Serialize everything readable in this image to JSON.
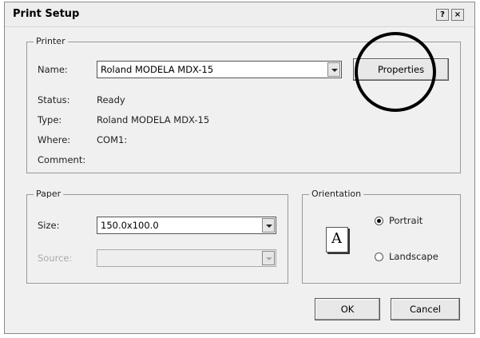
{
  "window": {
    "title": "Print Setup",
    "help_label": "?",
    "close_label": "×"
  },
  "printer": {
    "group_label": "Printer",
    "name_label": "Name:",
    "name_value": "Roland MODELA MDX-15",
    "properties_label": "Properties",
    "status_label": "Status:",
    "status_value": "Ready",
    "type_label": "Type:",
    "type_value": "Roland MODELA MDX-15",
    "where_label": "Where:",
    "where_value": "COM1:",
    "comment_label": "Comment:",
    "comment_value": ""
  },
  "paper": {
    "group_label": "Paper",
    "size_label": "Size:",
    "size_value": "150.0x100.0",
    "source_label": "Source:",
    "source_value": ""
  },
  "orientation": {
    "group_label": "Orientation",
    "icon_letter": "A",
    "portrait_label": "Portrait",
    "landscape_label": "Landscape",
    "selected": "Portrait"
  },
  "actions": {
    "ok_label": "OK",
    "cancel_label": "Cancel"
  }
}
